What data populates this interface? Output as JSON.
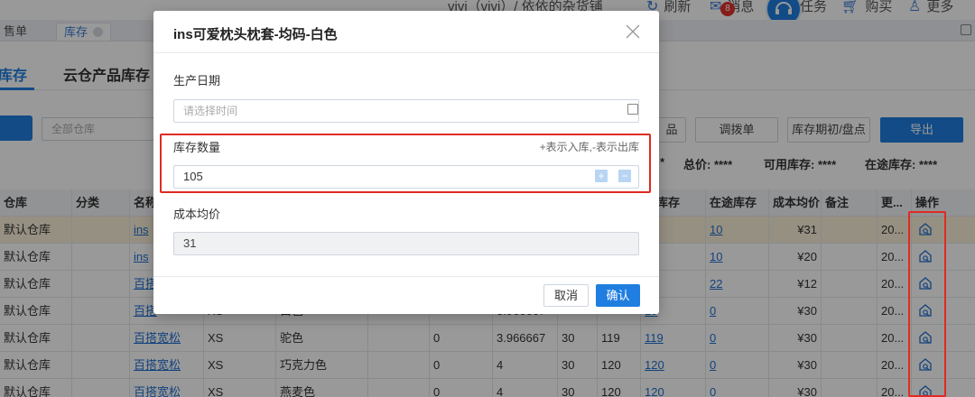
{
  "header": {
    "user": "vivi（vivi）/ 依依的杂货铺",
    "refresh": "刷新",
    "messages": "消息",
    "message_count": "8",
    "tasks": "任务",
    "buy": "购买",
    "more": "更多"
  },
  "tabs": [
    {
      "label": "售单"
    },
    {
      "label": "库存"
    }
  ],
  "subnav": {
    "tab1": "库存",
    "tab2": "云仓产品库存"
  },
  "toolbar": {
    "warehouse_placeholder": "全部仓库",
    "btn_partial": "品",
    "transfer": "调拨单",
    "inventory_count": "库存期初/盘点",
    "export": "导出"
  },
  "summary": {
    "star": "*",
    "total_price": "总价: ****",
    "available": "可用库存: ****",
    "in_transit": "在途库存: ****"
  },
  "table": {
    "headers": {
      "warehouse": "仓库",
      "category": "分类",
      "name": "名称",
      "available": "用库存",
      "in_transit": "在途库存",
      "avg_cost": "成本均价",
      "note": "备注",
      "updated": "更...",
      "op": "操作"
    },
    "rows": [
      {
        "warehouse": "默认仓库",
        "name": "ins",
        "size": "",
        "color": "",
        "c1": "",
        "c2": "",
        "c3": "",
        "c4": "",
        "avail": "",
        "transit": "10",
        "cost": "¥31",
        "updated": "20..."
      },
      {
        "warehouse": "默认仓库",
        "name": "ins",
        "size": "",
        "color": "",
        "c1": "",
        "c2": "",
        "c3": "",
        "c4": "",
        "avail": "",
        "transit": "10",
        "cost": "¥20",
        "updated": "20..."
      },
      {
        "warehouse": "默认仓库",
        "name": "百搭",
        "size": "",
        "color": "",
        "c1": "",
        "c2": "",
        "c3": "",
        "c4": "",
        "avail": "2",
        "transit": "22",
        "cost": "¥12",
        "updated": "20..."
      },
      {
        "warehouse": "默认仓库",
        "name": "百搭",
        "size": "XS",
        "color": "白色",
        "c1": "",
        "c2": "3.966667",
        "c3": "",
        "c4": "",
        "avail": "19",
        "transit": "0",
        "cost": "¥30",
        "updated": "20..."
      },
      {
        "warehouse": "默认仓库",
        "name": "百搭宽松",
        "size": "XS",
        "color": "驼色",
        "c1": "0",
        "c2": "3.966667",
        "c3": "30",
        "c4": "119",
        "avail": "119",
        "transit": "0",
        "cost": "¥30",
        "updated": "20..."
      },
      {
        "warehouse": "默认仓库",
        "name": "百搭宽松",
        "size": "XS",
        "color": "巧克力色",
        "c1": "0",
        "c2": "4",
        "c3": "30",
        "c4": "120",
        "avail": "120",
        "transit": "0",
        "cost": "¥30",
        "updated": "20..."
      },
      {
        "warehouse": "默认仓库",
        "name": "百搭宽松",
        "size": "XS",
        "color": "燕麦色",
        "c1": "0",
        "c2": "4",
        "c3": "30",
        "c4": "120",
        "avail": "120",
        "transit": "0",
        "cost": "¥30",
        "updated": "20..."
      }
    ]
  },
  "modal": {
    "title": "ins可爱枕头枕套-均码-白色",
    "production_date_label": "生产日期",
    "production_date_placeholder": "请选择时间",
    "qty_label": "库存数量",
    "qty_hint": "+表示入库,-表示出库",
    "qty_value": "105",
    "plus": "+",
    "minus": "−",
    "avg_cost_label": "成本均价",
    "avg_cost_value": "31",
    "cancel": "取消",
    "confirm": "确认"
  },
  "colors": {
    "primary": "#1f7ee0",
    "highlight_red": "#e02a22",
    "selected_row": "#fbf1d9"
  }
}
